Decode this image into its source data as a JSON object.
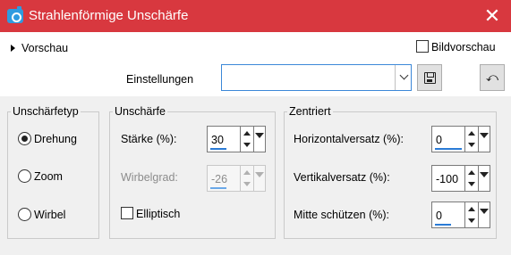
{
  "window": {
    "title": "Strahlenförmige Unschärfe",
    "close_glyph": "✕",
    "title_bar_color": "#d8383f"
  },
  "preview": {
    "toggle_label": "Vorschau",
    "bildvorschau_label": "Bildvorschau",
    "bildvorschau_checked": false
  },
  "settings": {
    "label": "Einstellungen",
    "value": "",
    "save_icon": "floppy-disk-icon",
    "reset_icon": "reset-icon"
  },
  "unschaerfetyp": {
    "legend": "Unschärfetyp",
    "options": [
      {
        "label": "Drehung",
        "checked": true
      },
      {
        "label": "Zoom",
        "checked": false
      },
      {
        "label": "Wirbel",
        "checked": false
      }
    ]
  },
  "unschaerfe": {
    "legend": "Unschärfe",
    "staerke": {
      "label": "Stärke (%):",
      "value": "30"
    },
    "wirbelgrad": {
      "label": "Wirbelgrad:",
      "value": "-26",
      "enabled": false
    },
    "elliptisch": {
      "label": "Elliptisch",
      "checked": false
    }
  },
  "zentriert": {
    "legend": "Zentriert",
    "horizontal": {
      "label": "Horizontalversatz (%):",
      "value": "0"
    },
    "vertikal": {
      "label": "Vertikalversatz (%):",
      "value": "-100"
    },
    "mitte": {
      "label": "Mitte schützen (%):",
      "value": "0"
    }
  }
}
